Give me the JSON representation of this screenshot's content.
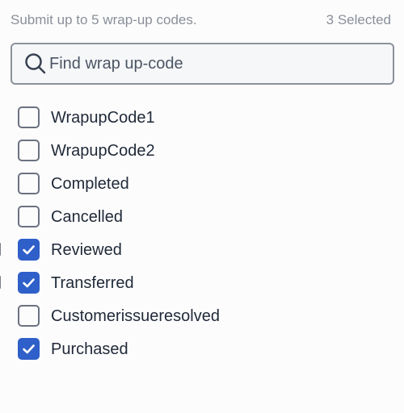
{
  "header": {
    "instruction": "Submit up to 5 wrap-up codes.",
    "selected_count": "3 Selected"
  },
  "search": {
    "placeholder": "Find wrap up-code",
    "value": "",
    "icon": "search-icon"
  },
  "codes": [
    {
      "label": "WrapupCode1",
      "checked": false
    },
    {
      "label": "WrapupCode2",
      "checked": false
    },
    {
      "label": "Completed",
      "checked": false
    },
    {
      "label": "Cancelled",
      "checked": false
    },
    {
      "label": "Reviewed",
      "checked": true
    },
    {
      "label": "Transferred",
      "checked": true
    },
    {
      "label": "Customerissueresolved",
      "checked": false
    },
    {
      "label": "Purchased",
      "checked": true
    }
  ],
  "colors": {
    "checked_fill": "#2f5fc9",
    "unchecked_border": "#6b7280",
    "muted_text": "#8a8f98"
  }
}
